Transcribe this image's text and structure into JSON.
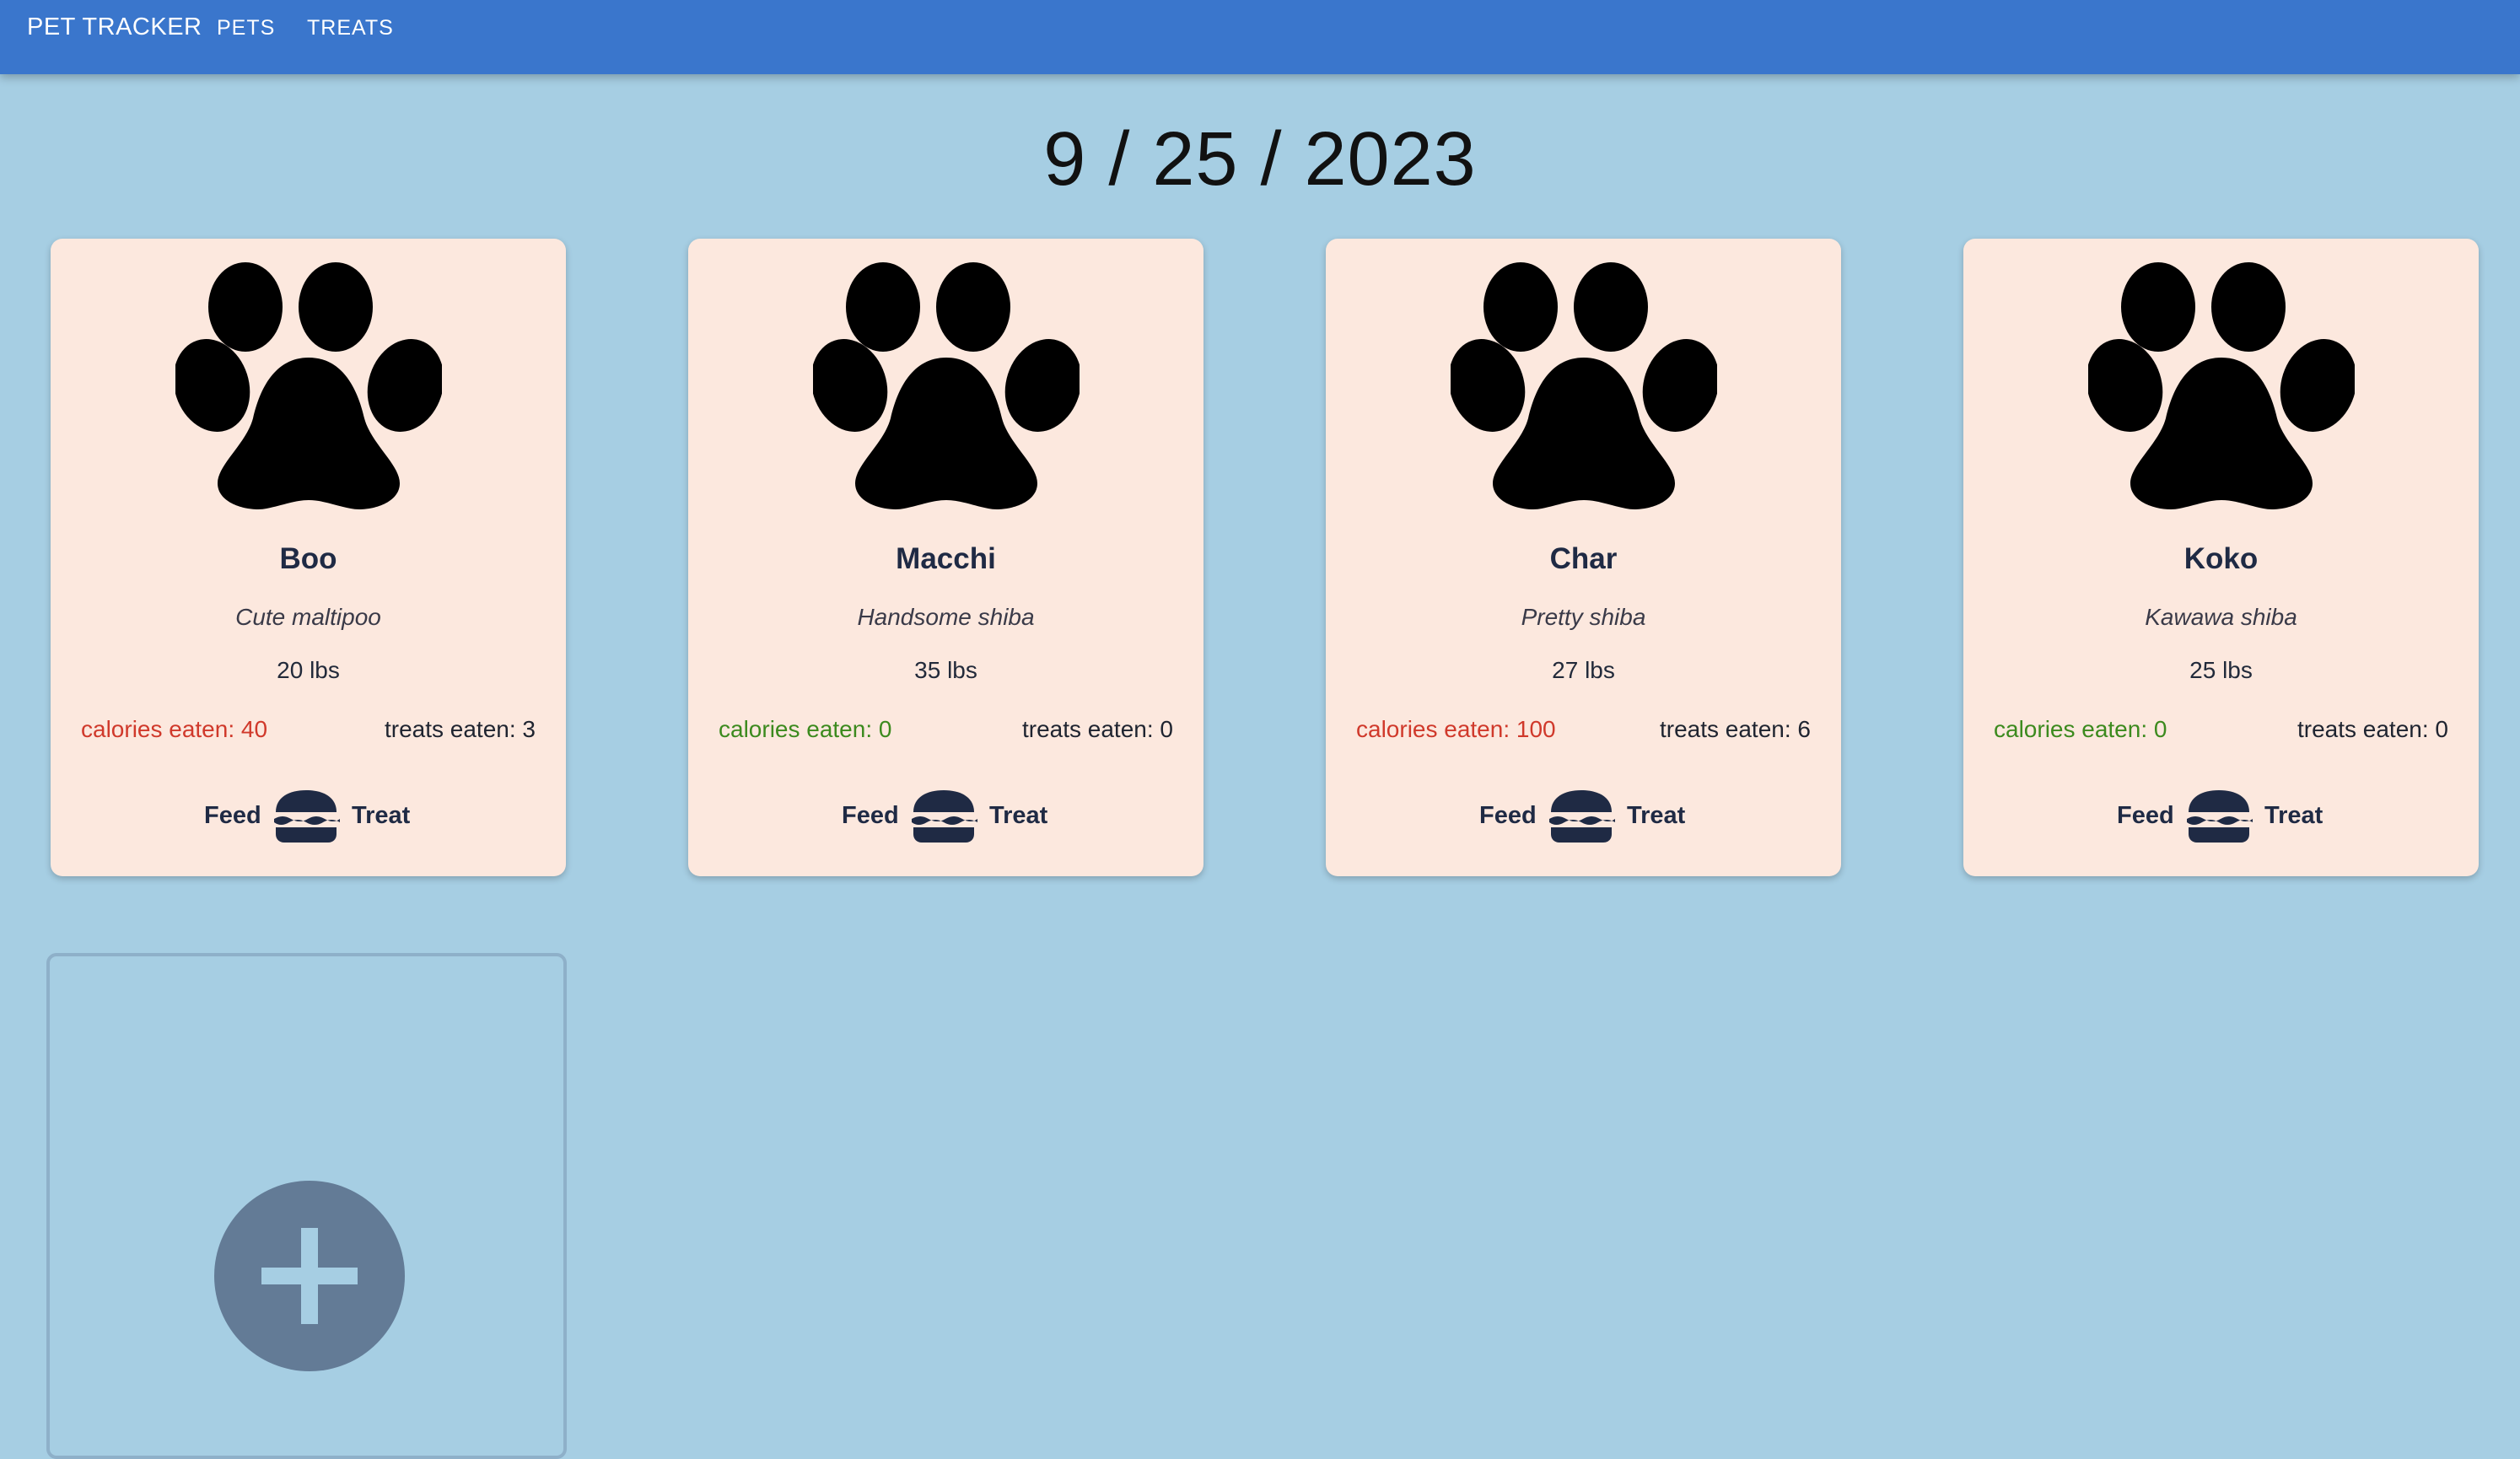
{
  "nav": {
    "brand": "PET TRACKER",
    "links": [
      "PETS",
      "TREATS"
    ]
  },
  "date": "9 / 25 / 2023",
  "colors": {
    "topbar": "#3a76cc",
    "background": "#a6cee3",
    "card": "#fce8de",
    "calories_high": "#d0392b",
    "calories_zero": "#3c8a1e",
    "add_button": "#637b96"
  },
  "pets": [
    {
      "name": "Boo",
      "description": "Cute maltipoo",
      "weight": "20 lbs",
      "calories": "calories eaten: 40",
      "calories_status": "high",
      "treats": "treats eaten: 3",
      "feed_label": "Feed",
      "treat_label": "Treat"
    },
    {
      "name": "Macchi",
      "description": "Handsome shiba",
      "weight": "35 lbs",
      "calories": "calories eaten: 0",
      "calories_status": "zero",
      "treats": "treats eaten: 0",
      "feed_label": "Feed",
      "treat_label": "Treat"
    },
    {
      "name": "Char",
      "description": "Pretty shiba",
      "weight": "27 lbs",
      "calories": "calories eaten: 100",
      "calories_status": "high",
      "treats": "treats eaten: 6",
      "feed_label": "Feed",
      "treat_label": "Treat"
    },
    {
      "name": "Koko",
      "description": "Kawawa shiba",
      "weight": "25 lbs",
      "calories": "calories eaten: 0",
      "calories_status": "zero",
      "treats": "treats eaten: 0",
      "feed_label": "Feed",
      "treat_label": "Treat"
    }
  ],
  "icons": {
    "paw": "paw-icon",
    "burger": "burger-icon",
    "add": "plus-icon"
  }
}
